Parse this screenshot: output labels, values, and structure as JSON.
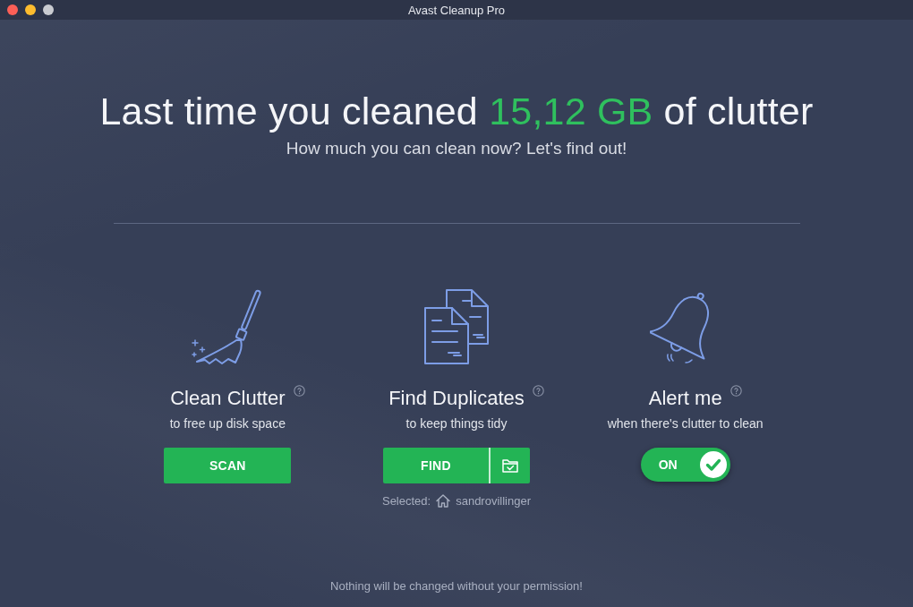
{
  "window": {
    "title": "Avast Cleanup Pro"
  },
  "headline": {
    "before": "Last time you cleaned",
    "amount": "15,12 GB",
    "after": "of clutter"
  },
  "subtitle": "How much you can clean now? Let's find out!",
  "features": [
    {
      "kind": "scan",
      "title": "Clean Clutter",
      "subtitle": "to free up disk space",
      "button": "SCAN"
    },
    {
      "kind": "find",
      "title": "Find Duplicates",
      "subtitle": "to keep things tidy",
      "button": "FIND",
      "selected_label": "Selected:",
      "selected_folder": "sandrovillinger"
    },
    {
      "kind": "alert",
      "title": "Alert me",
      "subtitle": "when there's clutter to clean",
      "toggle": {
        "label": "ON",
        "on": true
      }
    }
  ],
  "footer": "Nothing will be changed without your permission!"
}
